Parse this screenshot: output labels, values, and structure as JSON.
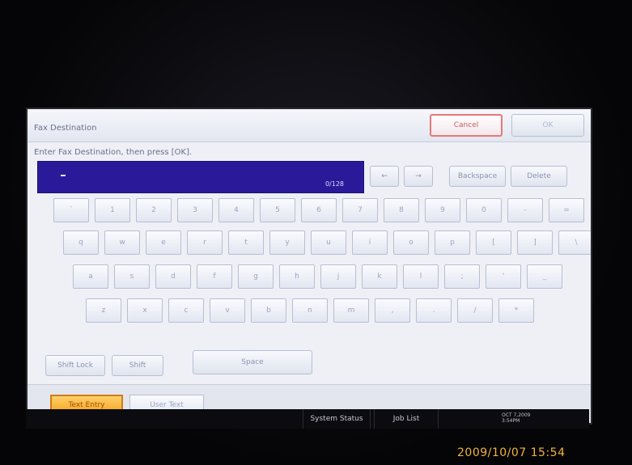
{
  "dialog": {
    "title": "Fax Destination",
    "cancel_label": "Cancel",
    "ok_label": "OK",
    "prompt": "Enter Fax Destination, then press [OK].",
    "entry_value": "-",
    "char_count": "0/128",
    "controls": {
      "left_arrow": "←",
      "right_arrow": "→",
      "backspace": "Backspace",
      "delete": "Delete"
    }
  },
  "keyboard": {
    "row1": [
      "`",
      "1",
      "2",
      "3",
      "4",
      "5",
      "6",
      "7",
      "8",
      "9",
      "0",
      "-",
      "="
    ],
    "row2": [
      "q",
      "w",
      "e",
      "r",
      "t",
      "y",
      "u",
      "i",
      "o",
      "p",
      "[",
      "]",
      "\\"
    ],
    "row3": [
      "a",
      "s",
      "d",
      "f",
      "g",
      "h",
      "j",
      "k",
      "l",
      ";",
      "'",
      "_"
    ],
    "row4": [
      "z",
      "x",
      "c",
      "v",
      "b",
      "n",
      "m",
      ",",
      ".",
      "/",
      "*"
    ],
    "shift_lock_label": "Shift Lock",
    "shift_label": "Shift",
    "space_label": "Space"
  },
  "tabs": [
    {
      "label": "Text Entry",
      "active": true
    },
    {
      "label": "User Text",
      "active": false
    }
  ],
  "status_bar": {
    "system_status_label": "System Status",
    "job_list_label": "Job List",
    "date": "OCT  7,2009",
    "time": "3:54PM"
  },
  "photo_timestamp": "2009/10/07 15:54"
}
